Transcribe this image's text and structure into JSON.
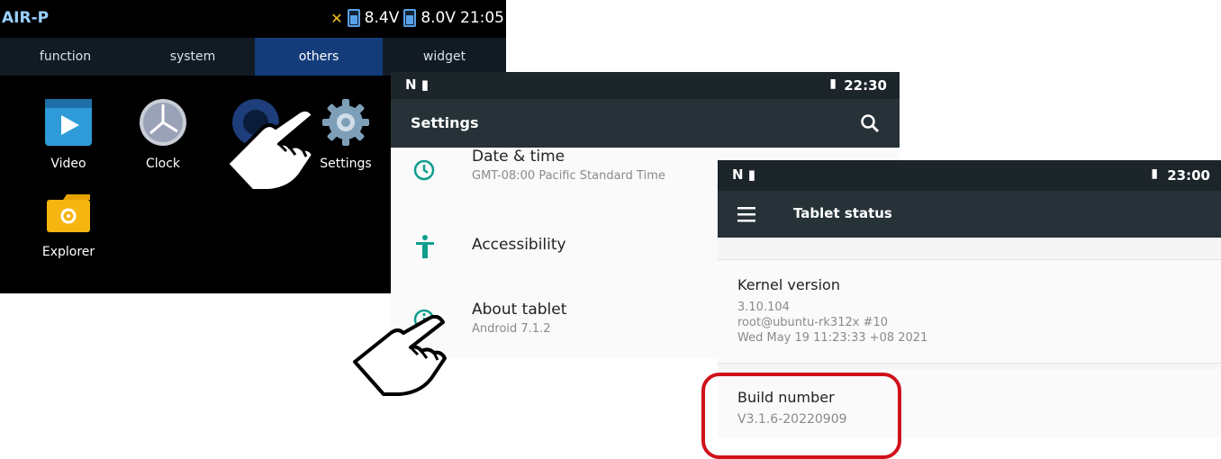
{
  "launcher": {
    "brand": "AIR-P",
    "battery1": "8.4V",
    "battery2": "8.0V",
    "time": "21:05",
    "tabs": [
      "function",
      "system",
      "others",
      "widget"
    ],
    "active_tab": "others",
    "apps": [
      {
        "label": "Video",
        "icon": "video-icon"
      },
      {
        "label": "Clock",
        "icon": "clock-icon"
      },
      {
        "label": "",
        "icon": "speaker-icon"
      },
      {
        "label": "Settings",
        "icon": "gear-icon"
      },
      {
        "label": "Explorer",
        "icon": "folder-icon"
      }
    ]
  },
  "settings": {
    "time": "22:30",
    "title": "Settings",
    "items": [
      {
        "title": "Date & time",
        "subtitle": "GMT-08:00 Pacific Standard Time",
        "icon": "clock-icon"
      },
      {
        "title": "Accessibility",
        "subtitle": "",
        "icon": "accessibility-icon"
      },
      {
        "title": "About tablet",
        "subtitle": "Android 7.1.2",
        "icon": "info-icon"
      }
    ]
  },
  "tablet_status": {
    "time": "23:00",
    "title": "Tablet status",
    "kernel": {
      "title": "Kernel version",
      "lines": [
        "3.10.104",
        "root@ubuntu-rk312x #10",
        "Wed May 19 11:23:33 +08 2021"
      ]
    },
    "build": {
      "title": "Build number",
      "value": "V3.1.6-20220909"
    }
  },
  "colors": {
    "highlight": "#d0121b",
    "accent": "#0f9d8e",
    "toolbar": "#263238",
    "active_tab": "#143c7a"
  }
}
